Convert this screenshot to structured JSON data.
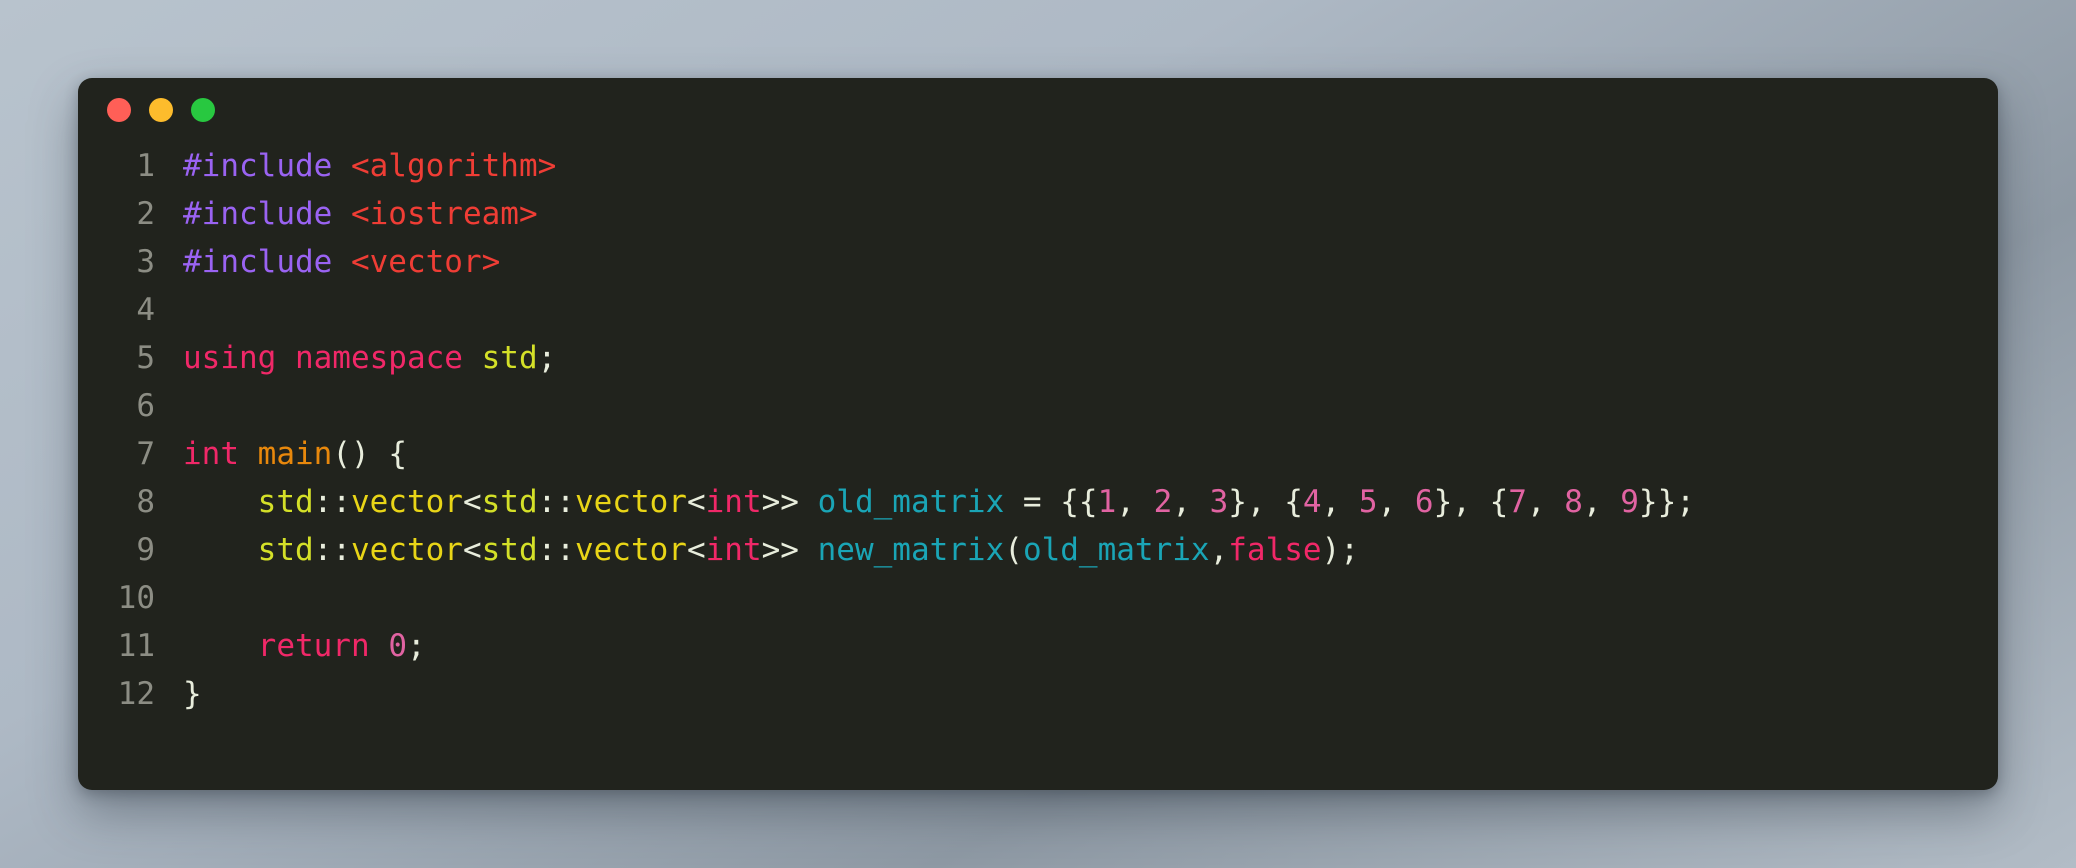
{
  "window": {
    "name": "code-snippet-window",
    "background_color": "#21231d",
    "page_background": "#b0bbc6",
    "traffic_lights": [
      {
        "name": "close-button",
        "label": "Close",
        "color": "#ff5f57"
      },
      {
        "name": "minimize-button",
        "label": "Minimize",
        "color": "#fdbc2c"
      },
      {
        "name": "maximize-button",
        "label": "Maximize",
        "color": "#28c840"
      }
    ]
  },
  "editor": {
    "language": "C++",
    "gutter_color": "#8c8d84",
    "default_text_color": "#e8eddc",
    "token_colors": {
      "preprocessor": "#9a63f2",
      "header": "#ef3d35",
      "keyword": "#f02868",
      "namespace": "#d4e028",
      "type": "#e9d517",
      "function": "#e8880c",
      "variable": "#1aa5b6",
      "number": "#e163a2",
      "punctuation": "#e8eddc"
    },
    "line_numbers": [
      "1",
      "2",
      "3",
      "4",
      "5",
      "6",
      "7",
      "8",
      "9",
      "10",
      "11",
      "12"
    ],
    "lines": [
      "#include <algorithm>",
      "#include <iostream>",
      "#include <vector>",
      "",
      "using namespace std;",
      "",
      "int main() {",
      "    std::vector<std::vector<int>> old_matrix = {{1, 2, 3}, {4, 5, 6}, {7, 8, 9}};",
      "    std::vector<std::vector<int>> new_matrix(old_matrix,false);",
      "",
      "    return 0;",
      "}"
    ],
    "tokens": [
      [
        {
          "t": "#include",
          "c": "t-pre"
        },
        {
          "t": " ",
          "c": "t-punct"
        },
        {
          "t": "<algorithm>",
          "c": "t-header"
        }
      ],
      [
        {
          "t": "#include",
          "c": "t-pre"
        },
        {
          "t": " ",
          "c": "t-punct"
        },
        {
          "t": "<iostream>",
          "c": "t-header"
        }
      ],
      [
        {
          "t": "#include",
          "c": "t-pre"
        },
        {
          "t": " ",
          "c": "t-punct"
        },
        {
          "t": "<vector>",
          "c": "t-header"
        }
      ],
      [],
      [
        {
          "t": "using namespace",
          "c": "t-kw"
        },
        {
          "t": " ",
          "c": "t-punct"
        },
        {
          "t": "std",
          "c": "t-ns"
        },
        {
          "t": ";",
          "c": "t-punct"
        }
      ],
      [],
      [
        {
          "t": "int",
          "c": "t-kw"
        },
        {
          "t": " ",
          "c": "t-punct"
        },
        {
          "t": "main",
          "c": "t-fn"
        },
        {
          "t": "() {",
          "c": "t-punct"
        }
      ],
      [
        {
          "t": "    ",
          "c": "t-punct"
        },
        {
          "t": "std",
          "c": "t-ns"
        },
        {
          "t": "::",
          "c": "t-punct"
        },
        {
          "t": "vector",
          "c": "t-type"
        },
        {
          "t": "<",
          "c": "t-punct"
        },
        {
          "t": "std",
          "c": "t-ns"
        },
        {
          "t": "::",
          "c": "t-punct"
        },
        {
          "t": "vector",
          "c": "t-type"
        },
        {
          "t": "<",
          "c": "t-punct"
        },
        {
          "t": "int",
          "c": "t-kw"
        },
        {
          "t": ">> ",
          "c": "t-punct"
        },
        {
          "t": "old_matrix",
          "c": "t-var"
        },
        {
          "t": " = {{",
          "c": "t-punct"
        },
        {
          "t": "1",
          "c": "t-num"
        },
        {
          "t": ", ",
          "c": "t-punct"
        },
        {
          "t": "2",
          "c": "t-num"
        },
        {
          "t": ", ",
          "c": "t-punct"
        },
        {
          "t": "3",
          "c": "t-num"
        },
        {
          "t": "}, {",
          "c": "t-punct"
        },
        {
          "t": "4",
          "c": "t-num"
        },
        {
          "t": ", ",
          "c": "t-punct"
        },
        {
          "t": "5",
          "c": "t-num"
        },
        {
          "t": ", ",
          "c": "t-punct"
        },
        {
          "t": "6",
          "c": "t-num"
        },
        {
          "t": "}, {",
          "c": "t-punct"
        },
        {
          "t": "7",
          "c": "t-num"
        },
        {
          "t": ", ",
          "c": "t-punct"
        },
        {
          "t": "8",
          "c": "t-num"
        },
        {
          "t": ", ",
          "c": "t-punct"
        },
        {
          "t": "9",
          "c": "t-num"
        },
        {
          "t": "}};",
          "c": "t-punct"
        }
      ],
      [
        {
          "t": "    ",
          "c": "t-punct"
        },
        {
          "t": "std",
          "c": "t-ns"
        },
        {
          "t": "::",
          "c": "t-punct"
        },
        {
          "t": "vector",
          "c": "t-type"
        },
        {
          "t": "<",
          "c": "t-punct"
        },
        {
          "t": "std",
          "c": "t-ns"
        },
        {
          "t": "::",
          "c": "t-punct"
        },
        {
          "t": "vector",
          "c": "t-type"
        },
        {
          "t": "<",
          "c": "t-punct"
        },
        {
          "t": "int",
          "c": "t-kw"
        },
        {
          "t": ">> ",
          "c": "t-punct"
        },
        {
          "t": "new_matrix",
          "c": "t-var"
        },
        {
          "t": "(",
          "c": "t-punct"
        },
        {
          "t": "old_matrix",
          "c": "t-var"
        },
        {
          "t": ",",
          "c": "t-punct"
        },
        {
          "t": "false",
          "c": "t-kw"
        },
        {
          "t": ");",
          "c": "t-punct"
        }
      ],
      [],
      [
        {
          "t": "    ",
          "c": "t-punct"
        },
        {
          "t": "return",
          "c": "t-kw"
        },
        {
          "t": " ",
          "c": "t-punct"
        },
        {
          "t": "0",
          "c": "t-num"
        },
        {
          "t": ";",
          "c": "t-punct"
        }
      ],
      [
        {
          "t": "}",
          "c": "t-punct"
        }
      ]
    ]
  }
}
